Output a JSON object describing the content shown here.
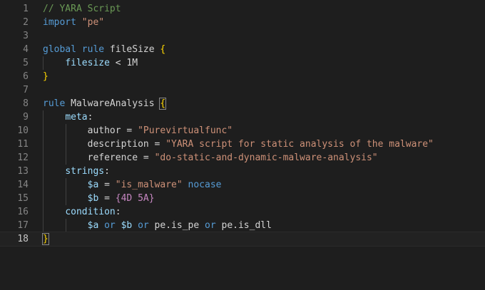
{
  "editor": {
    "language": "yara",
    "clipped_top_text": "// YARA Script",
    "current_line": 18,
    "lines": [
      {
        "number": "1",
        "indent": 0,
        "tokens": [
          {
            "t": "// YARA Script",
            "c": "tk-comment"
          }
        ]
      },
      {
        "number": "2",
        "indent": 0,
        "tokens": [
          {
            "t": "import",
            "c": "tk-keyword"
          },
          {
            "t": " ",
            "c": "tk-text"
          },
          {
            "t": "\"pe\"",
            "c": "tk-string"
          }
        ]
      },
      {
        "number": "3",
        "indent": 0,
        "tokens": []
      },
      {
        "number": "4",
        "indent": 0,
        "tokens": [
          {
            "t": "global",
            "c": "tk-keyword"
          },
          {
            "t": " ",
            "c": "tk-text"
          },
          {
            "t": "rule",
            "c": "tk-keyword"
          },
          {
            "t": " fileSize ",
            "c": "tk-text"
          },
          {
            "t": "{",
            "c": "tk-brace"
          }
        ]
      },
      {
        "number": "5",
        "indent": 1,
        "tokens": [
          {
            "t": "filesize",
            "c": "tk-var"
          },
          {
            "t": " < 1M",
            "c": "tk-text"
          }
        ]
      },
      {
        "number": "6",
        "indent": 0,
        "tokens": [
          {
            "t": "}",
            "c": "tk-brace"
          }
        ]
      },
      {
        "number": "7",
        "indent": 0,
        "tokens": []
      },
      {
        "number": "8",
        "indent": 0,
        "tokens": [
          {
            "t": "rule",
            "c": "tk-keyword"
          },
          {
            "t": " MalwareAnalysis ",
            "c": "tk-text"
          },
          {
            "t": "{",
            "c": "tk-brace cursor-brace"
          }
        ]
      },
      {
        "number": "9",
        "indent": 1,
        "tokens": [
          {
            "t": "meta",
            "c": "tk-var"
          },
          {
            "t": ":",
            "c": "tk-text"
          }
        ]
      },
      {
        "number": "10",
        "indent": 2,
        "tokens": [
          {
            "t": "author",
            "c": "tk-text"
          },
          {
            "t": " = ",
            "c": "tk-text"
          },
          {
            "t": "\"Purevirtualfunc\"",
            "c": "tk-string"
          }
        ]
      },
      {
        "number": "11",
        "indent": 2,
        "tokens": [
          {
            "t": "description",
            "c": "tk-text"
          },
          {
            "t": " = ",
            "c": "tk-text"
          },
          {
            "t": "\"YARA script for static analysis of the malware\"",
            "c": "tk-string"
          }
        ]
      },
      {
        "number": "12",
        "indent": 2,
        "tokens": [
          {
            "t": "reference",
            "c": "tk-text"
          },
          {
            "t": " = ",
            "c": "tk-text"
          },
          {
            "t": "\"do-static-and-dynamic-malware-analysis\"",
            "c": "tk-string"
          }
        ]
      },
      {
        "number": "13",
        "indent": 1,
        "tokens": [
          {
            "t": "strings",
            "c": "tk-var"
          },
          {
            "t": ":",
            "c": "tk-text"
          }
        ]
      },
      {
        "number": "14",
        "indent": 2,
        "tokens": [
          {
            "t": "$a",
            "c": "tk-var"
          },
          {
            "t": " = ",
            "c": "tk-text"
          },
          {
            "t": "\"is_malware\"",
            "c": "tk-string"
          },
          {
            "t": " ",
            "c": "tk-text"
          },
          {
            "t": "nocase",
            "c": "tk-keyword"
          }
        ]
      },
      {
        "number": "15",
        "indent": 2,
        "tokens": [
          {
            "t": "$b",
            "c": "tk-var"
          },
          {
            "t": " = ",
            "c": "tk-text"
          },
          {
            "t": "{4D 5A}",
            "c": "tk-hex"
          }
        ]
      },
      {
        "number": "16",
        "indent": 1,
        "tokens": [
          {
            "t": "condition",
            "c": "tk-var"
          },
          {
            "t": ":",
            "c": "tk-text"
          }
        ]
      },
      {
        "number": "17",
        "indent": 2,
        "tokens": [
          {
            "t": "$a",
            "c": "tk-var"
          },
          {
            "t": " ",
            "c": "tk-text"
          },
          {
            "t": "or",
            "c": "tk-keyword"
          },
          {
            "t": " ",
            "c": "tk-text"
          },
          {
            "t": "$b",
            "c": "tk-var"
          },
          {
            "t": " ",
            "c": "tk-text"
          },
          {
            "t": "or",
            "c": "tk-keyword"
          },
          {
            "t": " pe.is_pe ",
            "c": "tk-text"
          },
          {
            "t": "or",
            "c": "tk-keyword"
          },
          {
            "t": " pe.is_dll",
            "c": "tk-text"
          }
        ]
      },
      {
        "number": "18",
        "indent": 0,
        "tokens": [
          {
            "t": "}",
            "c": "tk-brace cursor-brace"
          }
        ]
      }
    ]
  },
  "colors": {
    "background": "#1e1e1e",
    "comment": "#6a9955",
    "keyword": "#569cd6",
    "string": "#ce9178",
    "variable": "#9cdcfe",
    "brace": "#ffd700",
    "hex": "#c586c0",
    "line_number": "#858585"
  }
}
